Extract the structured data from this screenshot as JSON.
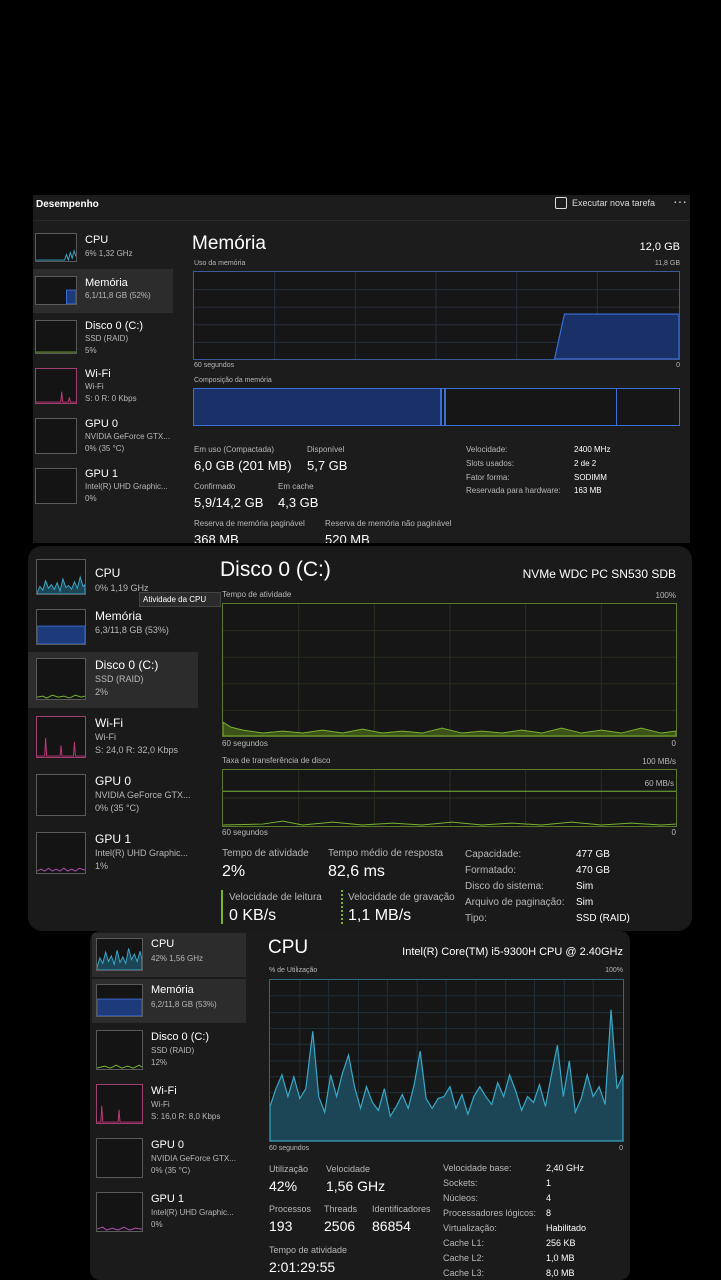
{
  "p1": {
    "header_title": "Desempenho",
    "run_task_label": "Executar nova tarefa",
    "more_label": "···",
    "sidebar": [
      {
        "name": "CPU",
        "sub1": "6%  1,32 GHz",
        "sub2": ""
      },
      {
        "name": "Memória",
        "sub1": "6,1/11,8 GB (52%)",
        "sub2": ""
      },
      {
        "name": "Disco 0 (C:)",
        "sub1": "SSD (RAID)",
        "sub2": "5%"
      },
      {
        "name": "Wi-Fi",
        "sub1": "Wi-Fi",
        "sub2": "S: 0 R: 0 Kbps"
      },
      {
        "name": "GPU 0",
        "sub1": "NVIDIA GeForce GTX...",
        "sub2": "0%  (35 °C)"
      },
      {
        "name": "GPU 1",
        "sub1": "Intel(R) UHD Graphic...",
        "sub2": "0%"
      }
    ],
    "title": "Memória",
    "total": "12,0 GB",
    "usage_label": "Uso da memória",
    "usage_max": "11,8 GB",
    "time_label": "60 segundos",
    "time_zero": "0",
    "composition_label": "Composição da memória",
    "stats": [
      {
        "label": "Em uso (Compactada)",
        "value": "6,0 GB (201 MB)"
      },
      {
        "label": "Disponível",
        "value": "5,7 GB"
      },
      {
        "label": "Confirmado",
        "value": "5,9/14,2 GB"
      },
      {
        "label": "Em cache",
        "value": "4,3 GB"
      },
      {
        "label": "Reserva de memória paginável",
        "value": "368 MB"
      },
      {
        "label": "Reserva de memória não paginável",
        "value": "520 MB"
      }
    ],
    "details": [
      {
        "label": "Velocidade:",
        "value": "2400 MHz"
      },
      {
        "label": "Slots usados:",
        "value": "2 de 2"
      },
      {
        "label": "Fator forma:",
        "value": "SODIMM"
      },
      {
        "label": "Reservada para hardware:",
        "value": "163 MB"
      }
    ]
  },
  "p2": {
    "sidebar": [
      {
        "name": "CPU",
        "sub1": "0%  1,19 GHz",
        "sub2": ""
      },
      {
        "name": "Memória",
        "sub1": "6,3/11,8 GB (53%)",
        "sub2": ""
      },
      {
        "name": "Disco 0 (C:)",
        "sub1": "SSD (RAID)",
        "sub2": "2%"
      },
      {
        "name": "Wi-Fi",
        "sub1": "Wi-Fi",
        "sub2": "S: 24,0 R: 32,0 Kbps"
      },
      {
        "name": "GPU 0",
        "sub1": "NVIDIA GeForce GTX...",
        "sub2": "0%  (35 °C)"
      },
      {
        "name": "GPU 1",
        "sub1": "Intel(R) UHD Graphic...",
        "sub2": "1%"
      }
    ],
    "tooltip": "Atividade da CPU",
    "title": "Disco 0 (C:)",
    "model": "NVMe WDC PC SN530 SDB",
    "activity_label": "Tempo de atividade",
    "activity_max": "100%",
    "time_label": "60 segundos",
    "time_zero": "0",
    "transfer_label": "Taxa de transferência de disco",
    "transfer_max": "100 MB/s",
    "transfer_line": "60 MB/s",
    "stats": [
      {
        "label": "Tempo de atividade",
        "value": "2%"
      },
      {
        "label": "Tempo médio de resposta",
        "value": "82,6 ms"
      },
      {
        "label": "Velocidade de leitura",
        "value": "0 KB/s"
      },
      {
        "label": "Velocidade de gravação",
        "value": "1,1 MB/s"
      }
    ],
    "details": [
      {
        "label": "Capacidade:",
        "value": "477 GB"
      },
      {
        "label": "Formatado:",
        "value": "470 GB"
      },
      {
        "label": "Disco do sistema:",
        "value": "Sim"
      },
      {
        "label": "Arquivo de paginação:",
        "value": "Sim"
      },
      {
        "label": "Tipo:",
        "value": "SSD (RAID)"
      }
    ]
  },
  "p3": {
    "sidebar": [
      {
        "name": "CPU",
        "sub1": "42%  1,56 GHz",
        "sub2": ""
      },
      {
        "name": "Memória",
        "sub1": "6,2/11,8 GB (53%)",
        "sub2": ""
      },
      {
        "name": "Disco 0 (C:)",
        "sub1": "SSD (RAID)",
        "sub2": "12%"
      },
      {
        "name": "Wi-Fi",
        "sub1": "Wi-Fi",
        "sub2": "S: 16,0 R: 8,0 Kbps"
      },
      {
        "name": "GPU 0",
        "sub1": "NVIDIA GeForce GTX...",
        "sub2": "0%  (35 °C)"
      },
      {
        "name": "GPU 1",
        "sub1": "Intel(R) UHD Graphic...",
        "sub2": "0%"
      }
    ],
    "title": "CPU",
    "model": "Intel(R) Core(TM) i5-9300H CPU @ 2.40GHz",
    "util_label": "% de Utilização",
    "util_max": "100%",
    "time_label": "60 segundos",
    "time_zero": "0",
    "stats": [
      {
        "label": "Utilização",
        "value": "42%"
      },
      {
        "label": "Velocidade",
        "value": "1,56 GHz"
      },
      {
        "label": "Processos",
        "value": "193"
      },
      {
        "label": "Threads",
        "value": "2506"
      },
      {
        "label": "Identificadores",
        "value": "86854"
      },
      {
        "label": "Tempo de atividade",
        "value": "2:01:29:55"
      }
    ],
    "details": [
      {
        "label": "Velocidade base:",
        "value": "2,40 GHz"
      },
      {
        "label": "Sockets:",
        "value": "1"
      },
      {
        "label": "Núcleos:",
        "value": "4"
      },
      {
        "label": "Processadores lógicos:",
        "value": "8"
      },
      {
        "label": "Virtualização:",
        "value": "Habilitado"
      },
      {
        "label": "Cache L1:",
        "value": "256 KB"
      },
      {
        "label": "Cache L2:",
        "value": "1,0 MB"
      },
      {
        "label": "Cache L3:",
        "value": "8,0 MB"
      }
    ]
  },
  "colors": {
    "cpu": "#3aa8c8",
    "memory": "#3a6fd8",
    "disk": "#7ab32e",
    "wifi": "#c2377a",
    "gpu": "#8a8a8a",
    "gpu1": "#b050b0"
  }
}
